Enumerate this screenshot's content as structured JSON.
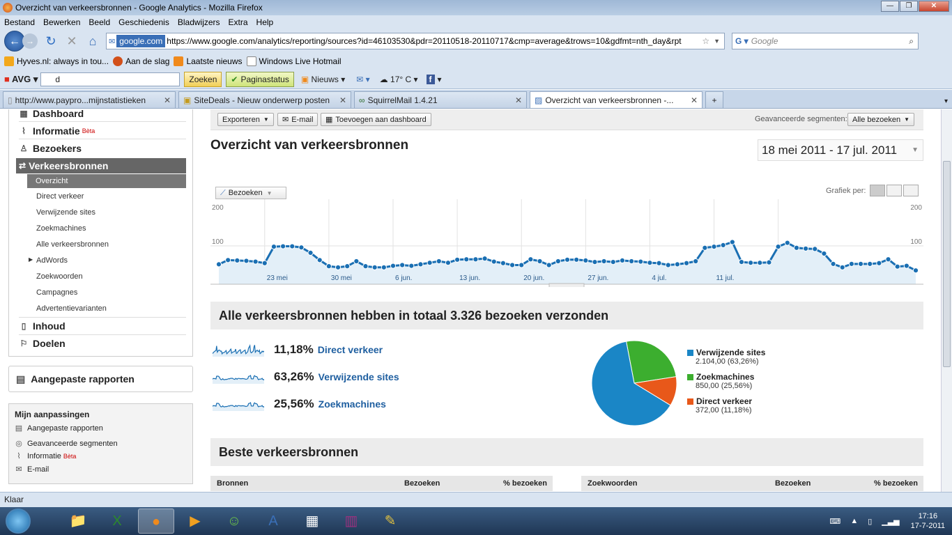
{
  "window": {
    "title": "Overzicht van verkeersbronnen - Google Analytics - Mozilla Firefox"
  },
  "menu": [
    "Bestand",
    "Bewerken",
    "Beeld",
    "Geschiedenis",
    "Bladwijzers",
    "Extra",
    "Help"
  ],
  "nav": {
    "site_badge": "google.com",
    "url": "https://www.google.com/analytics/reporting/sources?id=46103530&pdr=20110518-20110717&cmp=average&trows=10&gdfmt=nth_day&rpt",
    "search_placeholder": "Google"
  },
  "bookmarks": [
    "Hyves.nl: always in tou...",
    "Aan de slag",
    "Laatste nieuws",
    "Windows Live Hotmail"
  ],
  "avg": {
    "label": "AVG",
    "search_value": "d",
    "zoeken": "Zoeken",
    "paginastatus": "Paginastatus",
    "nieuws": "Nieuws",
    "weather": "17° C"
  },
  "tabs": [
    {
      "label": "http://www.paypro...mijnstatistieken"
    },
    {
      "label": "SiteDeals - Nieuw onderwerp posten"
    },
    {
      "label": "SquirrelMail 1.4.21"
    },
    {
      "label": "Overzicht van verkeersbronnen -..."
    }
  ],
  "sidebar": {
    "dashboard": "Dashboard",
    "informatie": "Informatie",
    "beta": "Bèta",
    "bezoekers": "Bezoekers",
    "verkeersbronnen": "Verkeersbronnen",
    "sub": [
      "Overzicht",
      "Direct verkeer",
      "Verwijzende sites",
      "Zoekmachines",
      "Alle verkeersbronnen",
      "AdWords",
      "Zoekwoorden",
      "Campagnes",
      "Advertentievarianten"
    ],
    "inhoud": "Inhoud",
    "doelen": "Doelen"
  },
  "custom_reports": "Aangepaste rapporten",
  "mijn": {
    "title": "Mijn aanpassingen",
    "items": [
      "Aangepaste rapporten",
      "Geavanceerde segmenten",
      "Informatie",
      "E-mail"
    ],
    "beta": "Bèta"
  },
  "toolbar": {
    "exporteren": "Exporteren",
    "email": "E-mail",
    "toevoegen": "Toevoegen aan dashboard",
    "segment_label": "Geavanceerde segmenten:",
    "segment_value": "Alle bezoeken"
  },
  "page": {
    "title": "Overzicht van verkeersbronnen",
    "daterange": "18 mei 2011 - 17 jul. 2011"
  },
  "chart_controls": {
    "metric": "Bezoeken",
    "grafiek": "Grafiek per:"
  },
  "chart_data": {
    "type": "area",
    "series": [
      {
        "name": "Bezoeken",
        "values": [
          52,
          63,
          62,
          61,
          59,
          55,
          98,
          99,
          99,
          96,
          82,
          63,
          47,
          44,
          47,
          60,
          47,
          44,
          44,
          48,
          50,
          48,
          52,
          56,
          60,
          56,
          64,
          65,
          65,
          67,
          59,
          55,
          50,
          50,
          65,
          60,
          50,
          60,
          64,
          64,
          62,
          58,
          60,
          58,
          62,
          60,
          59,
          56,
          55,
          50,
          52,
          55,
          60,
          95,
          98,
          102,
          110,
          58,
          56,
          56,
          57,
          98,
          108,
          95,
          93,
          92,
          80,
          53,
          44,
          53,
          53,
          53,
          55,
          65,
          46,
          48,
          36
        ]
      }
    ],
    "yaxis_labels_left": [
      "200",
      "100"
    ],
    "yaxis_labels_right": [
      "200",
      "100"
    ],
    "ylim": [
      0,
      200
    ],
    "x_tick_labels": [
      "23 mei",
      "30 mei",
      "6 jun.",
      "13 jun.",
      "20 jun.",
      "27 jun.",
      "4 jul.",
      "11 jul."
    ],
    "pie": {
      "type": "pie",
      "slices": [
        {
          "label": "Verwijzende sites",
          "value": 2104,
          "pct": 63.26,
          "text": "2.104,00 (63,26%)",
          "color": "#1a86c6"
        },
        {
          "label": "Zoekmachines",
          "value": 850,
          "pct": 25.56,
          "text": "850,00 (25,56%)",
          "color": "#3cae2f"
        },
        {
          "label": "Direct verkeer",
          "value": 372,
          "pct": 11.18,
          "text": "372,00 (11,18%)",
          "color": "#e8581a"
        }
      ]
    }
  },
  "summary": {
    "title": "Alle verkeersbronnen hebben in totaal 3.326 bezoeken verzonden",
    "rows": [
      {
        "pct": "11,18%",
        "label": "Direct verkeer"
      },
      {
        "pct": "63,26%",
        "label": "Verwijzende sites"
      },
      {
        "pct": "25,56%",
        "label": "Zoekmachines"
      }
    ]
  },
  "best": {
    "title": "Beste verkeersbronnen",
    "left_headers": [
      "Bronnen",
      "Bezoeken",
      "% bezoeken"
    ],
    "right_headers": [
      "Zoekwoorden",
      "Bezoeken",
      "% bezoeken"
    ]
  },
  "status": "Klaar",
  "clock": {
    "time": "17:16",
    "date": "17-7-2011"
  },
  "colors": {
    "link": "#1f5fa0",
    "chart_line": "#1a6fb3",
    "chart_fill": "#e3eff8"
  }
}
